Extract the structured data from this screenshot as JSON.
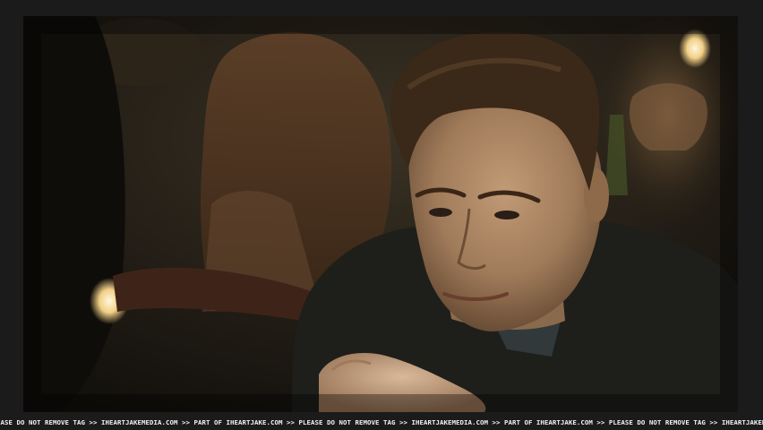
{
  "watermark": {
    "text": "EASE DO NOT REMOVE TAG >> IHEARTJAKEMEDIA.COM >> PART OF IHEARTJAKE.COM >> PLEASE DO NOT REMOVE TAG >> IHEARTJAKEMEDIA.COM >> PART OF IHEARTJAKE.COM >> PLEASE DO NOT REMOVE TAG >> IHEARTJAKEN"
  },
  "colors": {
    "frame": "#1b1b1b",
    "background": "#1c1812",
    "sweater": "#1e1f1b",
    "skin": "#a98462",
    "hair": "#3a2818",
    "warm_light": "#f0e0b0"
  }
}
